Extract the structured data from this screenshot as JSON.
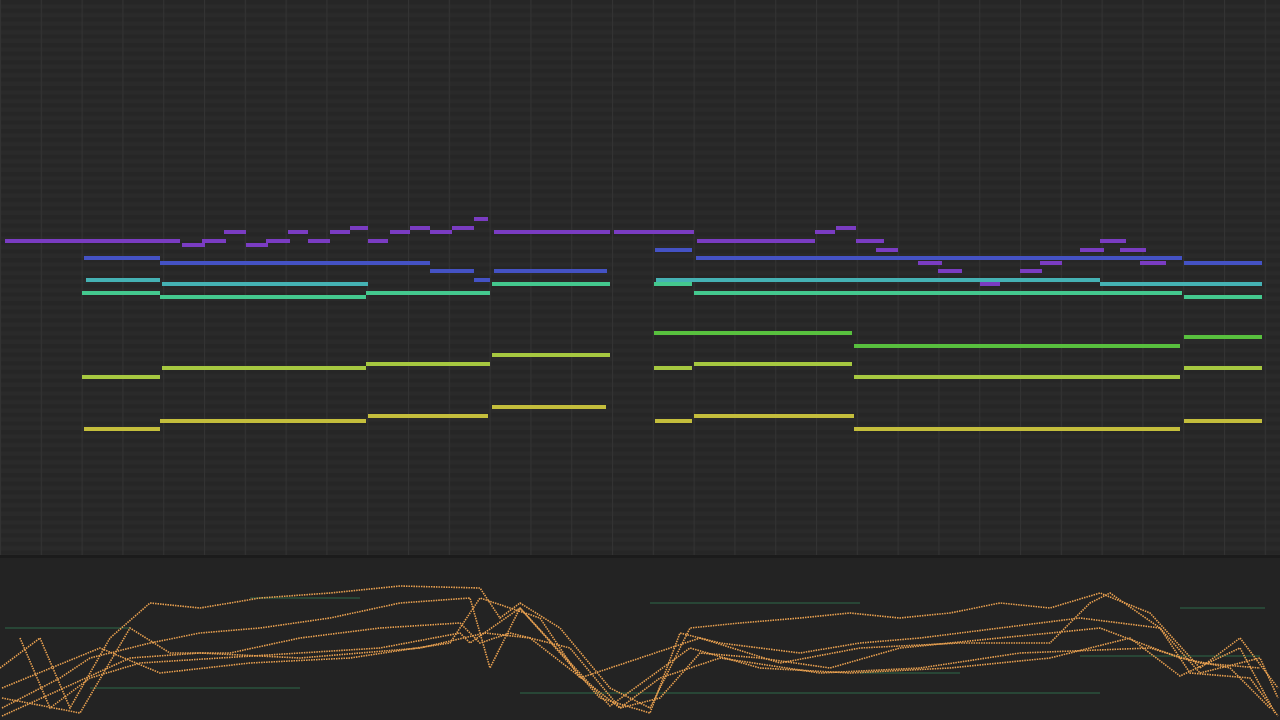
{
  "piano_roll": {
    "voices": [
      {
        "color": "#7a3cc2"
      },
      {
        "color": "#4452c4"
      },
      {
        "color": "#45b2b4"
      },
      {
        "color": "#44c88e"
      },
      {
        "color": "#58c03e"
      },
      {
        "color": "#a6c840"
      },
      {
        "color": "#c4be3c"
      }
    ]
  }
}
